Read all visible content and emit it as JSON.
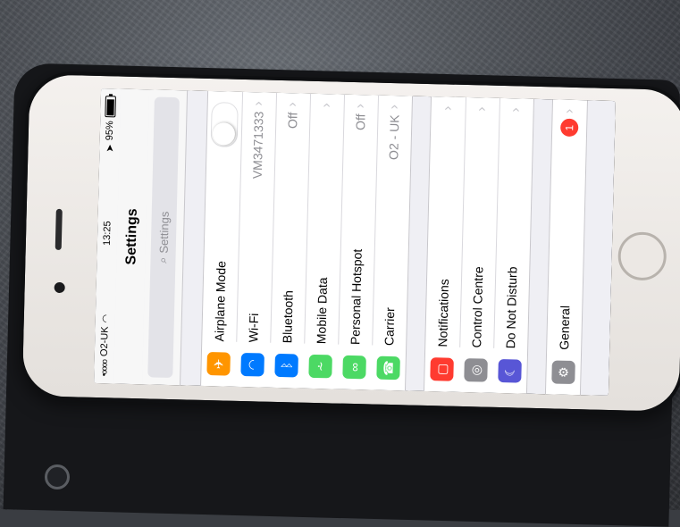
{
  "status": {
    "carrier": "O2-UK",
    "signal": "•oooo",
    "wifi_icon": "wifi-icon",
    "time": "13:25",
    "battery": "95%",
    "location_icon": "location-arrow-icon"
  },
  "nav": {
    "title": "Settings"
  },
  "search": {
    "placeholder": "Settings"
  },
  "groups": {
    "connectivity": [
      {
        "label": "Airplane Mode",
        "icon": "airplane-icon",
        "color": "#ff9500",
        "control": "toggle",
        "value": ""
      },
      {
        "label": "Wi-Fi",
        "icon": "wifi-icon",
        "color": "#007aff",
        "value": "VM3471333"
      },
      {
        "label": "Bluetooth",
        "icon": "bluetooth-icon",
        "color": "#007aff",
        "value": "Off"
      },
      {
        "label": "Mobile Data",
        "icon": "antenna-icon",
        "color": "#4cd964",
        "value": ""
      },
      {
        "label": "Personal Hotspot",
        "icon": "hotspot-icon",
        "color": "#4cd964",
        "value": "Off"
      },
      {
        "label": "Carrier",
        "icon": "phone-icon",
        "color": "#4cd964",
        "value": "O2 - UK"
      }
    ],
    "system": [
      {
        "label": "Notifications",
        "icon": "notifications-icon",
        "color": "#ff3b30"
      },
      {
        "label": "Control Centre",
        "icon": "control-centre-icon",
        "color": "#8e8e93"
      },
      {
        "label": "Do Not Disturb",
        "icon": "moon-icon",
        "color": "#5856d6"
      }
    ],
    "general": [
      {
        "label": "General",
        "icon": "gear-icon",
        "color": "#8e8e93",
        "badge": "1"
      }
    ]
  }
}
